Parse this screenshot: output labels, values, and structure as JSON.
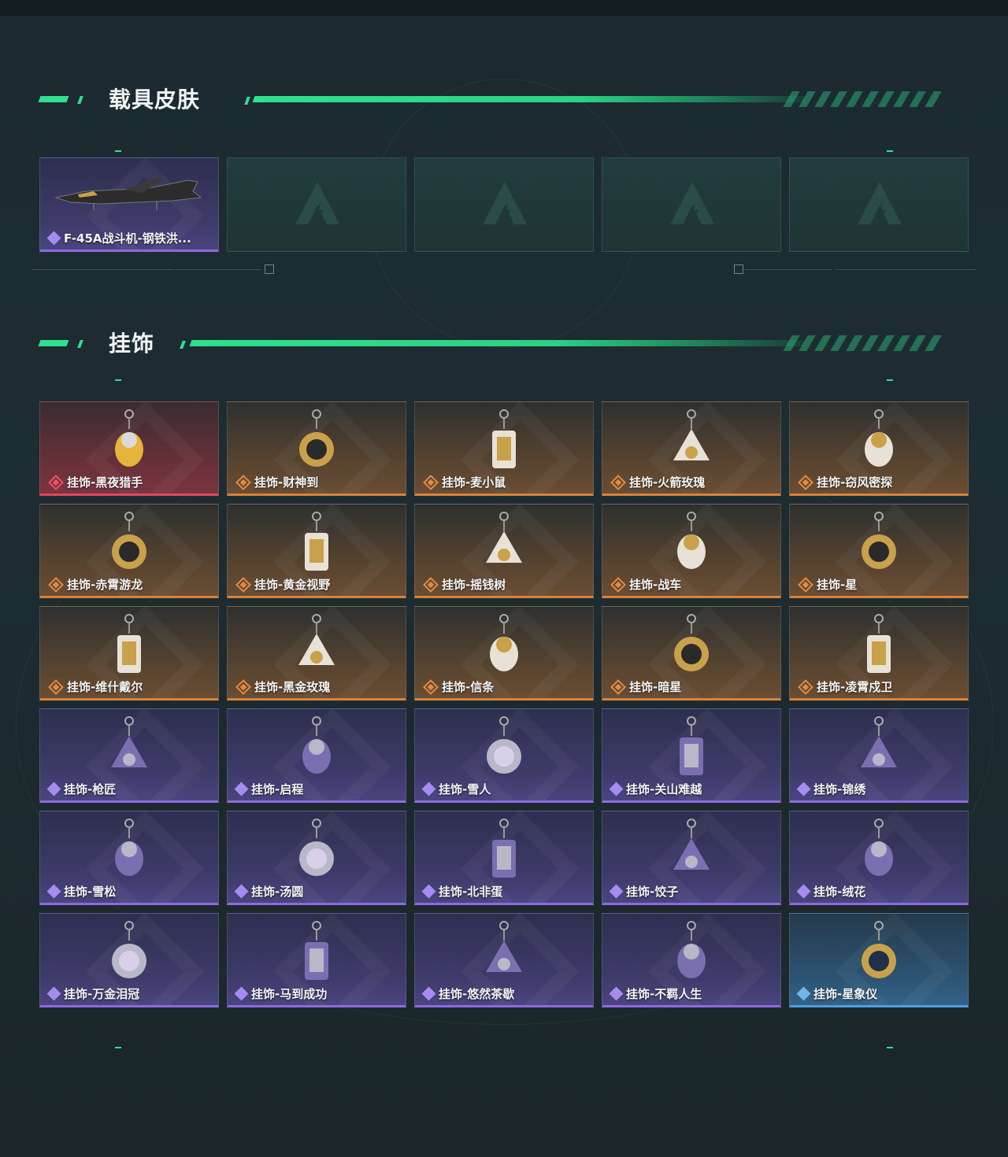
{
  "sections": {
    "vehicle": {
      "title": "载具皮肤"
    },
    "charms": {
      "title": "挂饰"
    }
  },
  "vehicle_skins": [
    {
      "label": "F-45A战斗机-钢铁洪...",
      "rarity": "purple"
    },
    {
      "label": "",
      "rarity": "empty"
    },
    {
      "label": "",
      "rarity": "empty"
    },
    {
      "label": "",
      "rarity": "empty"
    },
    {
      "label": "",
      "rarity": "empty"
    }
  ],
  "charms": [
    {
      "label": "挂饰-黑夜猎手",
      "rarity": "red"
    },
    {
      "label": "挂饰-财神到",
      "rarity": "orange"
    },
    {
      "label": "挂饰-麦小鼠",
      "rarity": "orange"
    },
    {
      "label": "挂饰-火箭玫瑰",
      "rarity": "orange"
    },
    {
      "label": "挂饰-窃风密探",
      "rarity": "orange"
    },
    {
      "label": "挂饰-赤霄游龙",
      "rarity": "orange"
    },
    {
      "label": "挂饰-黄金视野",
      "rarity": "orange"
    },
    {
      "label": "挂饰-摇钱树",
      "rarity": "orange"
    },
    {
      "label": "挂饰-战车",
      "rarity": "orange"
    },
    {
      "label": "挂饰-星",
      "rarity": "orange"
    },
    {
      "label": "挂饰-维什戴尔",
      "rarity": "orange"
    },
    {
      "label": "挂饰-黑金玫瑰",
      "rarity": "orange"
    },
    {
      "label": "挂饰-信条",
      "rarity": "orange"
    },
    {
      "label": "挂饰-暗星",
      "rarity": "orange"
    },
    {
      "label": "挂饰-凌霄戍卫",
      "rarity": "orange"
    },
    {
      "label": "挂饰-枪匠",
      "rarity": "purple"
    },
    {
      "label": "挂饰-启程",
      "rarity": "purple"
    },
    {
      "label": "挂饰-雪人",
      "rarity": "purple"
    },
    {
      "label": "挂饰-关山难越",
      "rarity": "purple"
    },
    {
      "label": "挂饰-锦绣",
      "rarity": "purple"
    },
    {
      "label": "挂饰-雪松",
      "rarity": "purple"
    },
    {
      "label": "挂饰-汤圆",
      "rarity": "purple"
    },
    {
      "label": "挂饰-北非蛋",
      "rarity": "purple"
    },
    {
      "label": "挂饰-饺子",
      "rarity": "purple"
    },
    {
      "label": "挂饰-绒花",
      "rarity": "purple"
    },
    {
      "label": "挂饰-万金泪冠",
      "rarity": "purple"
    },
    {
      "label": "挂饰-马到成功",
      "rarity": "purple"
    },
    {
      "label": "挂饰-悠然茶歇",
      "rarity": "purple"
    },
    {
      "label": "挂饰-不羁人生",
      "rarity": "purple"
    },
    {
      "label": "挂饰-星象仪",
      "rarity": "blue"
    }
  ],
  "colors": {
    "accent": "#2fe08f",
    "red": "#e2485a",
    "orange": "#d9833a",
    "purple": "#8d6ae0",
    "blue": "#4f9ede"
  }
}
